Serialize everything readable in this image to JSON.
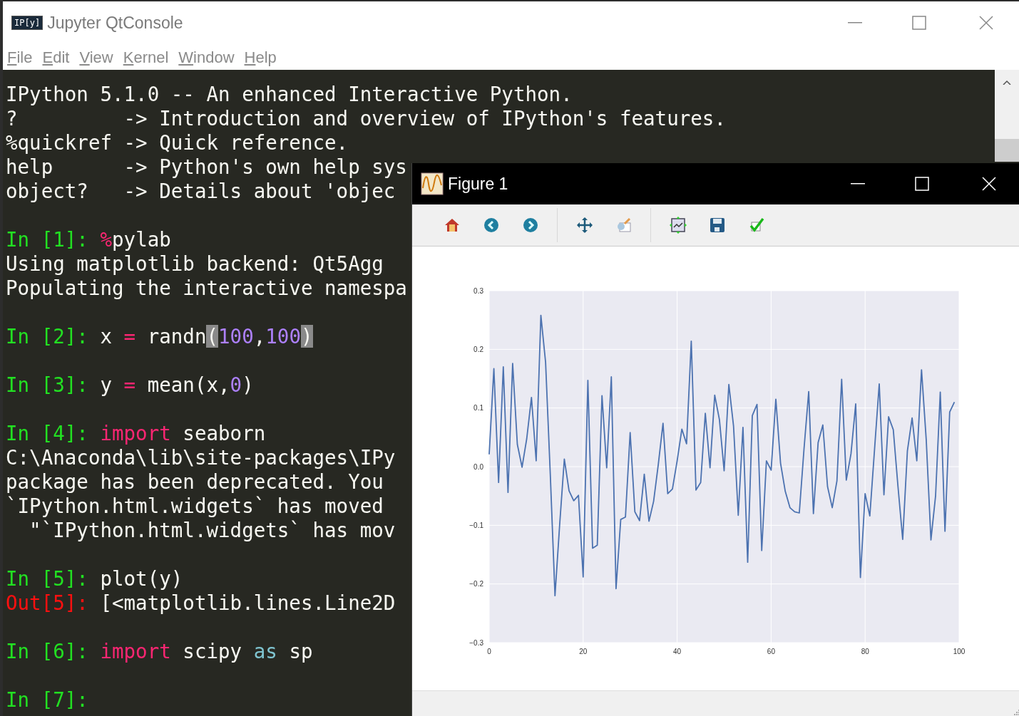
{
  "window": {
    "title": "Jupyter QtConsole",
    "logo_text": "IP[y]"
  },
  "menu": [
    {
      "label": "File"
    },
    {
      "label": "Edit"
    },
    {
      "label": "View"
    },
    {
      "label": "Kernel"
    },
    {
      "label": "Window"
    },
    {
      "label": "Help"
    }
  ],
  "console": {
    "lines": [
      {
        "kind": "text",
        "segments": [
          {
            "kind": "plain",
            "text": "IPython 5.1.0 -- An enhanced Interactive Python."
          }
        ]
      },
      {
        "kind": "text",
        "segments": [
          {
            "kind": "plain",
            "text": "?         -> Introduction and overview of IPython's features."
          }
        ]
      },
      {
        "kind": "text",
        "segments": [
          {
            "kind": "plain",
            "text": "%quickref -> Quick reference."
          }
        ]
      },
      {
        "kind": "text",
        "segments": [
          {
            "kind": "plain",
            "text": "help      -> Python's own help sys"
          }
        ]
      },
      {
        "kind": "text",
        "segments": [
          {
            "kind": "plain",
            "text": "object?   -> Details about 'objec"
          }
        ]
      },
      {
        "kind": "blank"
      },
      {
        "kind": "text",
        "segments": [
          {
            "kind": "prompt_in",
            "text": "In [1]: "
          },
          {
            "kind": "operator",
            "text": "%"
          },
          {
            "kind": "plain",
            "text": "pylab"
          }
        ]
      },
      {
        "kind": "text",
        "segments": [
          {
            "kind": "plain",
            "text": "Using matplotlib backend: Qt5Agg"
          }
        ]
      },
      {
        "kind": "text",
        "segments": [
          {
            "kind": "plain",
            "text": "Populating the interactive namespa"
          }
        ]
      },
      {
        "kind": "blank"
      },
      {
        "kind": "text",
        "segments": [
          {
            "kind": "prompt_in",
            "text": "In [2]: "
          },
          {
            "kind": "plain",
            "text": "x "
          },
          {
            "kind": "operator",
            "text": "="
          },
          {
            "kind": "plain",
            "text": " randn"
          },
          {
            "kind": "bracket_match",
            "text": "("
          },
          {
            "kind": "number",
            "text": "100"
          },
          {
            "kind": "plain",
            "text": ","
          },
          {
            "kind": "number",
            "text": "100"
          },
          {
            "kind": "bracket_match",
            "text": ")"
          }
        ]
      },
      {
        "kind": "blank"
      },
      {
        "kind": "text",
        "segments": [
          {
            "kind": "prompt_in",
            "text": "In [3]: "
          },
          {
            "kind": "plain",
            "text": "y "
          },
          {
            "kind": "operator",
            "text": "="
          },
          {
            "kind": "plain",
            "text": " mean(x,"
          },
          {
            "kind": "number",
            "text": "0"
          },
          {
            "kind": "plain",
            "text": ")"
          }
        ]
      },
      {
        "kind": "blank"
      },
      {
        "kind": "text",
        "segments": [
          {
            "kind": "prompt_in",
            "text": "In [4]: "
          },
          {
            "kind": "keyword",
            "text": "import"
          },
          {
            "kind": "plain",
            "text": " seaborn"
          }
        ]
      },
      {
        "kind": "text",
        "segments": [
          {
            "kind": "plain",
            "text": "C:\\Anaconda\\lib\\site-packages\\IPy"
          }
        ]
      },
      {
        "kind": "text",
        "segments": [
          {
            "kind": "plain",
            "text": "package has been deprecated. You"
          }
        ]
      },
      {
        "kind": "text",
        "segments": [
          {
            "kind": "plain",
            "text": "`IPython.html.widgets` has moved"
          }
        ]
      },
      {
        "kind": "text",
        "segments": [
          {
            "kind": "plain",
            "text": "  \"`IPython.html.widgets` has mov"
          }
        ]
      },
      {
        "kind": "blank"
      },
      {
        "kind": "text",
        "segments": [
          {
            "kind": "prompt_in",
            "text": "In [5]: "
          },
          {
            "kind": "plain",
            "text": "plot(y)"
          }
        ]
      },
      {
        "kind": "text",
        "segments": [
          {
            "kind": "prompt_out",
            "text": "Out[5]: "
          },
          {
            "kind": "plain",
            "text": "[<matplotlib.lines.Line2D"
          }
        ]
      },
      {
        "kind": "blank"
      },
      {
        "kind": "text",
        "segments": [
          {
            "kind": "prompt_in",
            "text": "In [6]: "
          },
          {
            "kind": "keyword",
            "text": "import"
          },
          {
            "kind": "plain",
            "text": " scipy "
          },
          {
            "kind": "builtin",
            "text": "as"
          },
          {
            "kind": "plain",
            "text": " sp"
          }
        ]
      },
      {
        "kind": "blank"
      },
      {
        "kind": "text",
        "segments": [
          {
            "kind": "prompt_in",
            "text": "In [7]: "
          }
        ]
      }
    ]
  },
  "figure": {
    "title": "Figure 1",
    "toolbar": [
      {
        "kind": "home"
      },
      {
        "kind": "back"
      },
      {
        "kind": "forward"
      },
      {
        "kind": "separator"
      },
      {
        "kind": "pan"
      },
      {
        "kind": "edit"
      },
      {
        "kind": "separator"
      },
      {
        "kind": "subplots"
      },
      {
        "kind": "save"
      },
      {
        "kind": "check"
      }
    ],
    "chart_data": {
      "type": "line",
      "x": [
        0,
        1,
        2,
        3,
        4,
        5,
        6,
        7,
        8,
        9,
        10,
        11,
        12,
        13,
        14,
        15,
        16,
        17,
        18,
        19,
        20,
        21,
        22,
        23,
        24,
        25,
        26,
        27,
        28,
        29,
        30,
        31,
        32,
        33,
        34,
        35,
        36,
        37,
        38,
        39,
        40,
        41,
        42,
        43,
        44,
        45,
        46,
        47,
        48,
        49,
        50,
        51,
        52,
        53,
        54,
        55,
        56,
        57,
        58,
        59,
        60,
        61,
        62,
        63,
        64,
        65,
        66,
        67,
        68,
        69,
        70,
        71,
        72,
        73,
        74,
        75,
        76,
        77,
        78,
        79,
        80,
        81,
        82,
        83,
        84,
        85,
        86,
        87,
        88,
        89,
        90,
        91,
        92,
        93,
        94,
        95,
        96,
        97,
        98,
        99
      ],
      "series": [
        {
          "color": "#4c72b0",
          "values": [
            0.021,
            0.167,
            -0.027,
            0.17,
            -0.044,
            0.176,
            0.038,
            -0.001,
            0.048,
            0.118,
            0.01,
            0.258,
            0.178,
            -0.013,
            -0.22,
            -0.1,
            0.013,
            -0.041,
            -0.058,
            -0.049,
            -0.188,
            0.147,
            -0.139,
            -0.134,
            0.121,
            -0.002,
            0.153,
            -0.208,
            -0.09,
            -0.086,
            0.058,
            -0.077,
            -0.092,
            -0.013,
            -0.093,
            -0.059,
            0.004,
            0.074,
            -0.046,
            -0.038,
            0.01,
            0.064,
            0.039,
            0.214,
            -0.04,
            -0.027,
            0.091,
            -0.002,
            0.122,
            0.08,
            -0.007,
            0.14,
            0.069,
            -0.083,
            0.067,
            -0.163,
            0.087,
            0.106,
            -0.143,
            0.01,
            -0.006,
            0.115,
            0.006,
            -0.042,
            -0.07,
            -0.077,
            -0.079,
            0.03,
            0.128,
            -0.08,
            0.041,
            0.071,
            -0.034,
            -0.07,
            -0.024,
            0.149,
            -0.023,
            0.022,
            0.107,
            -0.189,
            -0.046,
            -0.084,
            0.029,
            0.141,
            -0.048,
            0.085,
            0.063,
            -0.034,
            -0.124,
            0.027,
            0.083,
            0.01,
            0.165,
            0.046,
            -0.125,
            -0.05,
            0.127,
            -0.11,
            0.093,
            0.11
          ]
        }
      ],
      "grid": true,
      "xlim": [
        0,
        100
      ],
      "ylim": [
        -0.3,
        0.3
      ],
      "xticks": [
        0,
        20,
        40,
        60,
        80,
        100
      ],
      "yticks": [
        {
          "value": -0.3,
          "label": "−0.3"
        },
        {
          "value": -0.2,
          "label": "−0.2"
        },
        {
          "value": -0.1,
          "label": "−0.1"
        },
        {
          "value": 0,
          "label": "0.0"
        },
        {
          "value": 0.1,
          "label": "0.1"
        },
        {
          "value": 0.2,
          "label": "0.2"
        },
        {
          "value": 0.3,
          "label": "0.3"
        }
      ]
    }
  }
}
